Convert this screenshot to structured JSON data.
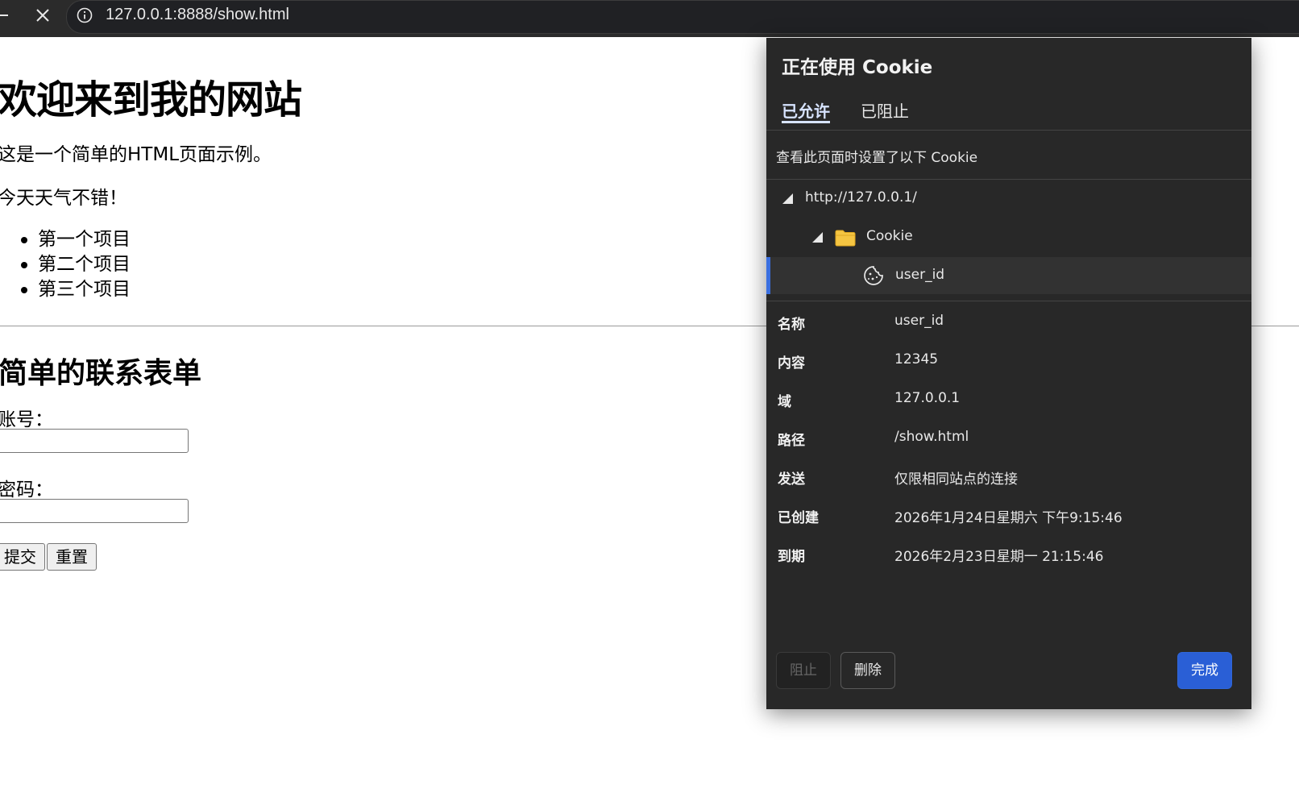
{
  "browser": {
    "url": "127.0.0.1:8888/show.html"
  },
  "page": {
    "heading": "欢迎来到我的网站",
    "paragraphs": [
      "这是一个简单的HTML页面示例。",
      "今天天气不错！"
    ],
    "list_items": [
      "第一个项目",
      "第二个项目",
      "第三个项目"
    ],
    "form_heading": "简单的联系表单",
    "account_label": "账号：",
    "password_label": "密码：",
    "submit_label": "提交",
    "reset_label": "重置"
  },
  "cookie_popup": {
    "title": "正在使用 Cookie",
    "tabs": [
      "已允许",
      "已阻止"
    ],
    "active_tab": "已允许",
    "subtitle": "查看此页面时设置了以下 Cookie",
    "tree": {
      "site": "http://127.0.0.1/",
      "folder": "Cookie",
      "cookie": "user_id"
    },
    "details": [
      {
        "key": "名称",
        "value": "user_id"
      },
      {
        "key": "内容",
        "value": "12345"
      },
      {
        "key": "域",
        "value": "127.0.0.1"
      },
      {
        "key": "路径",
        "value": "/show.html"
      },
      {
        "key": "发送",
        "value": "仅限相同站点的连接"
      },
      {
        "key": "已创建",
        "value": "2026年1月24日星期六 下午9:15:46"
      },
      {
        "key": "到期",
        "value": "2026年2月23日星期一 21:15:46"
      }
    ],
    "buttons": {
      "block": "阻止",
      "delete": "删除",
      "done": "完成"
    },
    "colors": {
      "accent": "#2a5fd6",
      "background": "#282828",
      "folder": "#f5c542"
    }
  }
}
